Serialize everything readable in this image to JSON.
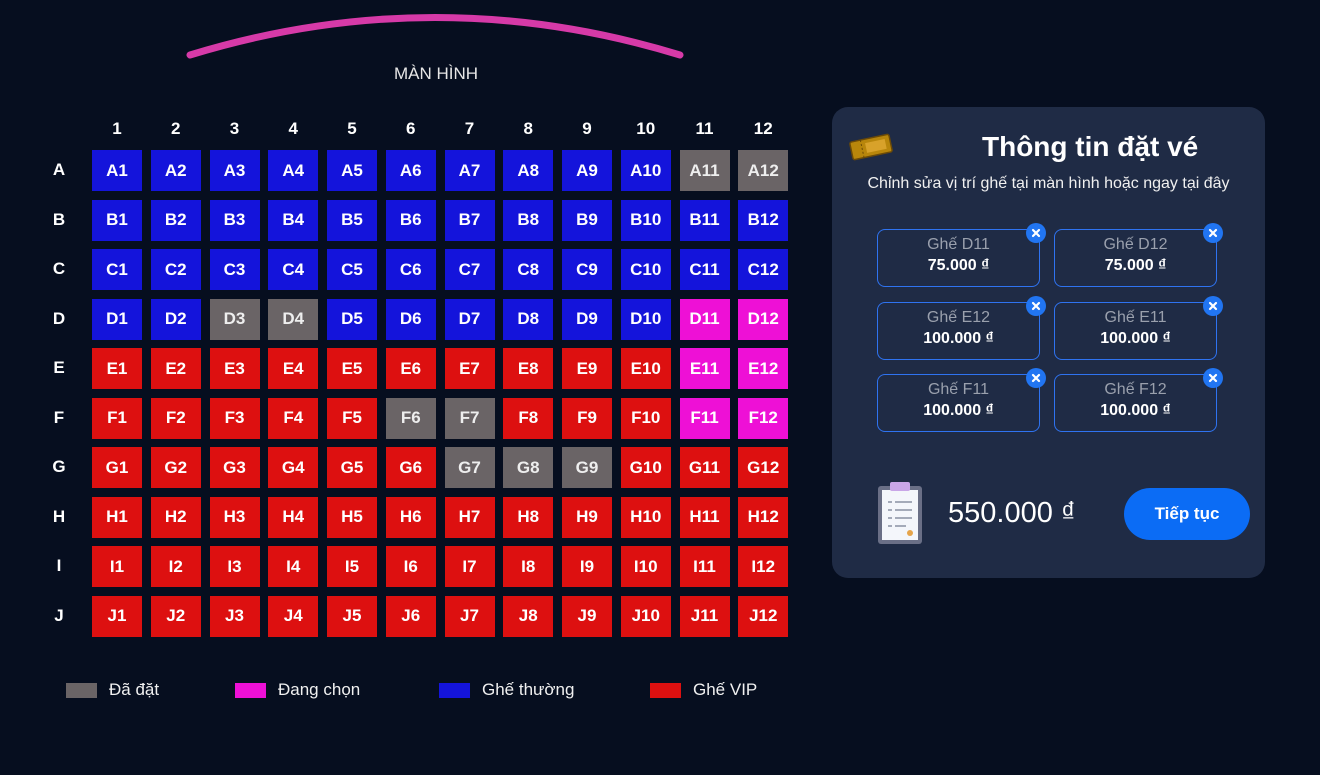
{
  "screen": {
    "label": "MÀN HÌNH"
  },
  "columns": [
    "1",
    "2",
    "3",
    "4",
    "5",
    "6",
    "7",
    "8",
    "9",
    "10",
    "11",
    "12"
  ],
  "rows": [
    "A",
    "B",
    "C",
    "D",
    "E",
    "F",
    "G",
    "H",
    "I",
    "J"
  ],
  "seats": {
    "A": [
      "normal",
      "normal",
      "normal",
      "normal",
      "normal",
      "normal",
      "normal",
      "normal",
      "normal",
      "normal",
      "booked",
      "booked"
    ],
    "B": [
      "normal",
      "normal",
      "normal",
      "normal",
      "normal",
      "normal",
      "normal",
      "normal",
      "normal",
      "normal",
      "normal",
      "normal"
    ],
    "C": [
      "normal",
      "normal",
      "normal",
      "normal",
      "normal",
      "normal",
      "normal",
      "normal",
      "normal",
      "normal",
      "normal",
      "normal"
    ],
    "D": [
      "normal",
      "normal",
      "booked",
      "booked",
      "normal",
      "normal",
      "normal",
      "normal",
      "normal",
      "normal",
      "selected",
      "selected"
    ],
    "E": [
      "vip",
      "vip",
      "vip",
      "vip",
      "vip",
      "vip",
      "vip",
      "vip",
      "vip",
      "vip",
      "selected",
      "selected"
    ],
    "F": [
      "vip",
      "vip",
      "vip",
      "vip",
      "vip",
      "booked",
      "booked",
      "vip",
      "vip",
      "vip",
      "selected",
      "selected"
    ],
    "G": [
      "vip",
      "vip",
      "vip",
      "vip",
      "vip",
      "vip",
      "booked",
      "booked",
      "booked",
      "vip",
      "vip",
      "vip"
    ],
    "H": [
      "vip",
      "vip",
      "vip",
      "vip",
      "vip",
      "vip",
      "vip",
      "vip",
      "vip",
      "vip",
      "vip",
      "vip"
    ],
    "I": [
      "vip",
      "vip",
      "vip",
      "vip",
      "vip",
      "vip",
      "vip",
      "vip",
      "vip",
      "vip",
      "vip",
      "vip"
    ],
    "J": [
      "vip",
      "vip",
      "vip",
      "vip",
      "vip",
      "vip",
      "vip",
      "vip",
      "vip",
      "vip",
      "vip",
      "vip"
    ]
  },
  "seat_colors": {
    "normal": "#1414db",
    "vip": "#dd1010",
    "booked": "#6a6466",
    "selected": "#ee10d6"
  },
  "legend": [
    {
      "label": "Đã đặt",
      "color": "#6a6466"
    },
    {
      "label": "Đang chọn",
      "color": "#ee10d6"
    },
    {
      "label": "Ghế thường",
      "color": "#1414db"
    },
    {
      "label": "Ghế VIP",
      "color": "#dd1010"
    }
  ],
  "panel": {
    "title": "Thông tin đặt vé",
    "subtitle": "Chỉnh sửa vị trí ghế tại màn hình hoặc ngay tại đây",
    "selected": [
      {
        "name": "Ghế D11",
        "price": "75.000 ₫"
      },
      {
        "name": "Ghế D12",
        "price": "75.000 ₫"
      },
      {
        "name": "Ghế E12",
        "price": "100.000 ₫"
      },
      {
        "name": "Ghế E11",
        "price": "100.000 ₫"
      },
      {
        "name": "Ghế F11",
        "price": "100.000 ₫"
      },
      {
        "name": "Ghế F12",
        "price": "100.000 ₫"
      }
    ],
    "total": "550.000 ₫",
    "continue_label": "Tiếp tục"
  }
}
